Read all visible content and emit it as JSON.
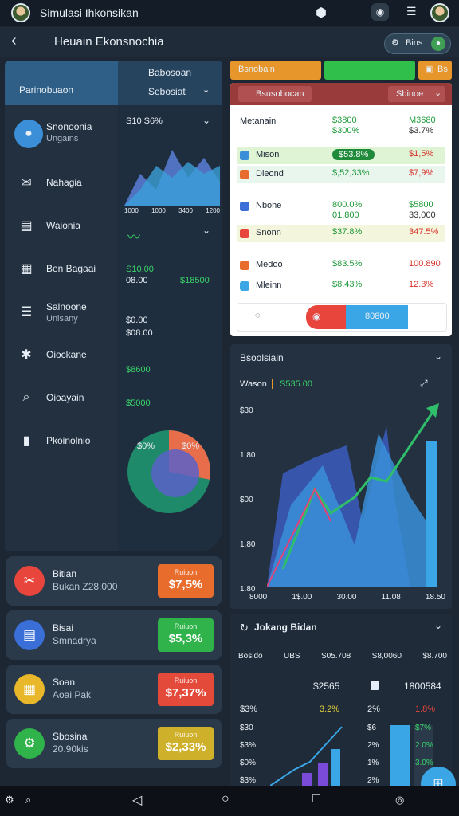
{
  "status": {
    "title": "Simulasi Ihkonsikan"
  },
  "header": {
    "title": "Heuain Ekonsnochia",
    "pill_label": "Bins"
  },
  "left_header": {
    "left_label": "Parinobuaon",
    "right_top": "Babosoan",
    "right_bottom": "Sebosiat"
  },
  "menu": [
    {
      "label": "Snonoonia",
      "sub": "Ungains",
      "icon": "bag-icon"
    },
    {
      "label": "Nahagia",
      "sub": "",
      "icon": "mail-icon"
    },
    {
      "label": "Waionia",
      "sub": "",
      "icon": "clipboard-icon"
    },
    {
      "label": "Ben Bagaai",
      "sub": "",
      "icon": "document-icon"
    },
    {
      "label": "Salnoone",
      "sub": "Unisany",
      "icon": "list-icon"
    },
    {
      "label": "Oiockane",
      "sub": "",
      "icon": "puzzle-icon"
    },
    {
      "label": "Oioayain",
      "sub": "",
      "icon": "search-icon"
    },
    {
      "label": "Pkoinolnio",
      "sub": "",
      "icon": "phone-icon"
    }
  ],
  "mini": {
    "chart_top_label": "S10 S6%",
    "chart_ticks": [
      "1000",
      "1000",
      "3400",
      "1200"
    ],
    "val_a1": "S10.00",
    "val_a2": "08.00",
    "val_a3": "$18500",
    "val_b1": "$0.00",
    "val_b2": "$08.00",
    "val_c": "$8600",
    "val_d": "$5000",
    "pie_green": "$0%",
    "pie_red": "$0%",
    "pie_split": [
      0.28,
      0.72
    ]
  },
  "cards": [
    {
      "title": "Bitian",
      "sub": "Bukan Z28.000",
      "badge_top": "Ruiuon",
      "badge_value": "$7,5%",
      "badge_color": "#e86d2c",
      "circle_color": "#e8453c",
      "icon": "scissors-icon"
    },
    {
      "title": "Bisai",
      "sub": "Smnadrya",
      "badge_top": "Ruiuon",
      "badge_value": "$5,3%",
      "badge_color": "#2fb34a",
      "circle_color": "#3a6fd8",
      "icon": "clipboard-icon"
    },
    {
      "title": "Soan",
      "sub": "Aoai Pak",
      "badge_top": "Ruiuon",
      "badge_value": "$7,37%",
      "badge_color": "#e34a3a",
      "circle_color": "#e8b82a",
      "icon": "document-icon"
    },
    {
      "title": "Sbosina",
      "sub": "20.90kis",
      "badge_top": "Ruiuon",
      "badge_value": "$2,33%",
      "badge_color": "#cfb02a",
      "circle_color": "#2fb34a",
      "icon": "gear-icon"
    }
  ],
  "tabs": [
    {
      "label": "Bsnobain",
      "color": "#e6962a"
    },
    {
      "label": "",
      "color": "#2fbf4a"
    },
    {
      "label": "Bs",
      "color": "#e6962a"
    }
  ],
  "watchlist": {
    "head_left": "Bsusobocan",
    "head_right": "Sbinoe",
    "rows": [
      {
        "name": "Metanain",
        "v1": "$3800",
        "v1b": "$300%",
        "v2": "M3680",
        "v2b": "$3.7%",
        "highlight": ""
      },
      {
        "name": "Mison",
        "v1": "$53.8%",
        "v1b": "",
        "v2": "$1,5%",
        "v2b": "",
        "highlight": "#dff3d5"
      },
      {
        "name": "Dieond",
        "v1": "$,52,33%",
        "v1b": "",
        "v2": "$7,9%",
        "v2b": "",
        "highlight": "#e9f6ee"
      },
      {
        "name": "Nbohe",
        "v1": "800.0%",
        "v1b": "01.800",
        "v2": "$5800",
        "v2b": "33,000",
        "highlight": ""
      },
      {
        "name": "Snonn",
        "v1": "$37.8%",
        "v1b": "",
        "v2": "347.5%",
        "v2b": "",
        "highlight": "#f4f5dd"
      },
      {
        "name": "Medoo",
        "v1": "$83.5%",
        "v1b": "",
        "v2": "100.890",
        "v2b": "",
        "highlight": ""
      },
      {
        "name": "Mleinn",
        "v1": "$8.43%",
        "v1b": "",
        "v2": "12.3%",
        "v2b": "",
        "highlight": ""
      }
    ],
    "footer_btn": "80800"
  },
  "bigchart": {
    "title": "Bsoolsiain",
    "legend_label": "Wason",
    "legend_value": "S535.00",
    "y_ticks": [
      "$30",
      "1.80",
      "$00",
      "1.80",
      "1.80"
    ],
    "x_ticks": [
      "8000",
      "1$.00",
      "30.00",
      "11.08",
      "18.50"
    ]
  },
  "bottom": {
    "title": "Jokang Bidan",
    "col_heads": [
      "Bosido",
      "UBS",
      "S05.708",
      "S8,0060",
      "$8.700"
    ],
    "mid_left": "$2565",
    "mid_right": "1800584",
    "row1": [
      "$3%",
      "3.2%",
      "2%",
      "1.8%"
    ],
    "left_ticks": [
      "$30",
      "$3%",
      "$0%",
      "$3%"
    ],
    "right_ticks": [
      "$6",
      "2%",
      "1%",
      "2%"
    ],
    "inner_ticks": [
      "$7%",
      "2.0%",
      "3.0%"
    ]
  }
}
